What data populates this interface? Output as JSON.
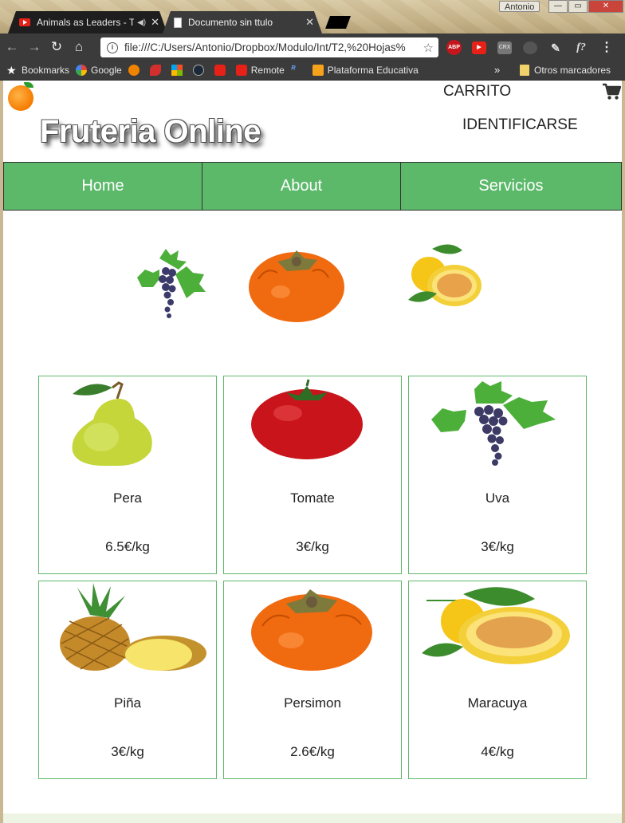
{
  "browser": {
    "tabs": [
      {
        "title": "Animals as Leaders - T",
        "active": false,
        "favicon": "youtube-icon"
      },
      {
        "title": "Documento sin ttulo",
        "active": true,
        "favicon": "document-icon"
      }
    ],
    "profile_name": "Antonio",
    "url": "file:///C:/Users/Antonio/Dropbox/Modulo/Int/T2,%20Hojas%",
    "bookmarks": [
      {
        "label": "Bookmarks",
        "icon": "star-icon"
      },
      {
        "label": "Google",
        "icon": "google-icon"
      },
      {
        "label": "",
        "icon": "avast-icon"
      },
      {
        "label": "",
        "icon": "swirl-icon"
      },
      {
        "label": "",
        "icon": "windows-icon"
      },
      {
        "label": "",
        "icon": "steam-icon"
      },
      {
        "label": "",
        "icon": "youtube-icon"
      },
      {
        "label": "Remote",
        "icon": "youtube-icon"
      },
      {
        "label": "",
        "icon": "r-icon"
      },
      {
        "label": "Plataforma Educativa",
        "icon": "moodle-icon"
      }
    ],
    "other_bookmarks": "Otros marcadores",
    "more": "»"
  },
  "site": {
    "title": "Fruteria Online",
    "cart_label": "CARRITO",
    "login_label": "IDENTIFICARSE",
    "nav": [
      {
        "label": "Home"
      },
      {
        "label": "About"
      },
      {
        "label": "Servicios"
      }
    ],
    "featured": [
      {
        "fruit": "grapes"
      },
      {
        "fruit": "persimmon"
      },
      {
        "fruit": "passion-fruit"
      }
    ],
    "products": [
      {
        "name": "Pera",
        "price": "6.5€/kg",
        "fruit": "pear"
      },
      {
        "name": "Tomate",
        "price": "3€/kg",
        "fruit": "tomato"
      },
      {
        "name": "Uva",
        "price": "3€/kg",
        "fruit": "grapes"
      },
      {
        "name": "Piña",
        "price": "3€/kg",
        "fruit": "pineapple"
      },
      {
        "name": "Persimon",
        "price": "2.6€/kg",
        "fruit": "persimmon"
      },
      {
        "name": "Maracuya",
        "price": "4€/kg",
        "fruit": "passion-fruit"
      }
    ]
  },
  "colors": {
    "nav_green": "#5cb96a",
    "card_border": "#5cb96a",
    "browser_dark": "#3b3b3b"
  }
}
